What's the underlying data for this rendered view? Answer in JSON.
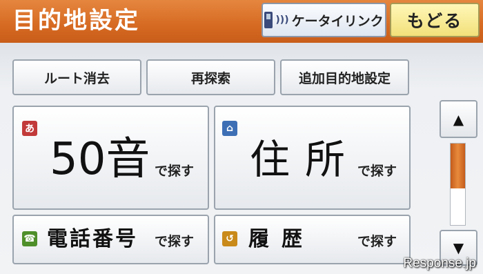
{
  "header": {
    "title": "目的地設定",
    "keitai_link_label": "ケータイリンク",
    "back_label": "もどる"
  },
  "actions": {
    "route_delete": "ルート消去",
    "research": "再探索",
    "add_destination": "追加目的地設定"
  },
  "search": {
    "kana": {
      "badge": "あ",
      "label": "50音",
      "suffix": "で探す"
    },
    "address": {
      "label_1": "住",
      "label_2": "所",
      "suffix": "で探す"
    },
    "phone": {
      "label": "電話番号",
      "suffix": "で探す"
    },
    "history": {
      "label_1": "履",
      "label_2": "歴",
      "suffix": "で探す"
    }
  },
  "scroll": {
    "up": "▲",
    "down": "▼",
    "position": 0.55
  },
  "watermark": "Response.jp",
  "colors": {
    "header": "#d66a22",
    "back_button": "#f2e07a",
    "scroll_thumb": "#e07a2a"
  }
}
